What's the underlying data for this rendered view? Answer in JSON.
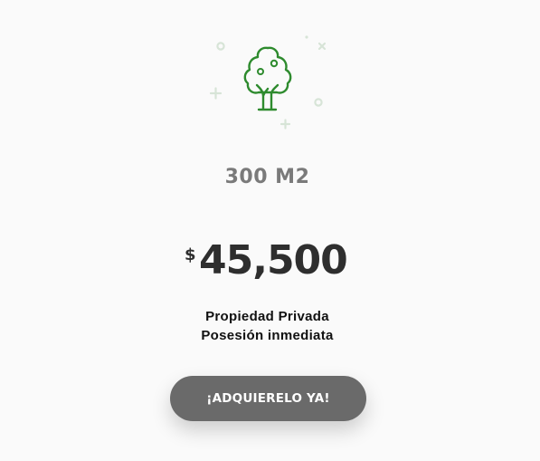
{
  "plan": {
    "illustration_icon": "tree-icon",
    "size_label": "300 M2",
    "currency_symbol": "$",
    "price": "45,500",
    "features": [
      "Propiedad Privada",
      "Posesión inmediata"
    ],
    "cta_label": "¡ADQUIERELO YA!"
  },
  "colors": {
    "background": "#fafafa",
    "tree_stroke": "#2e8b2e",
    "decor": "#d9e6d9",
    "price_text": "#2e2e2e",
    "size_text": "#7a7a7a",
    "button_bg": "#6a6a6a",
    "button_text": "#ffffff"
  }
}
